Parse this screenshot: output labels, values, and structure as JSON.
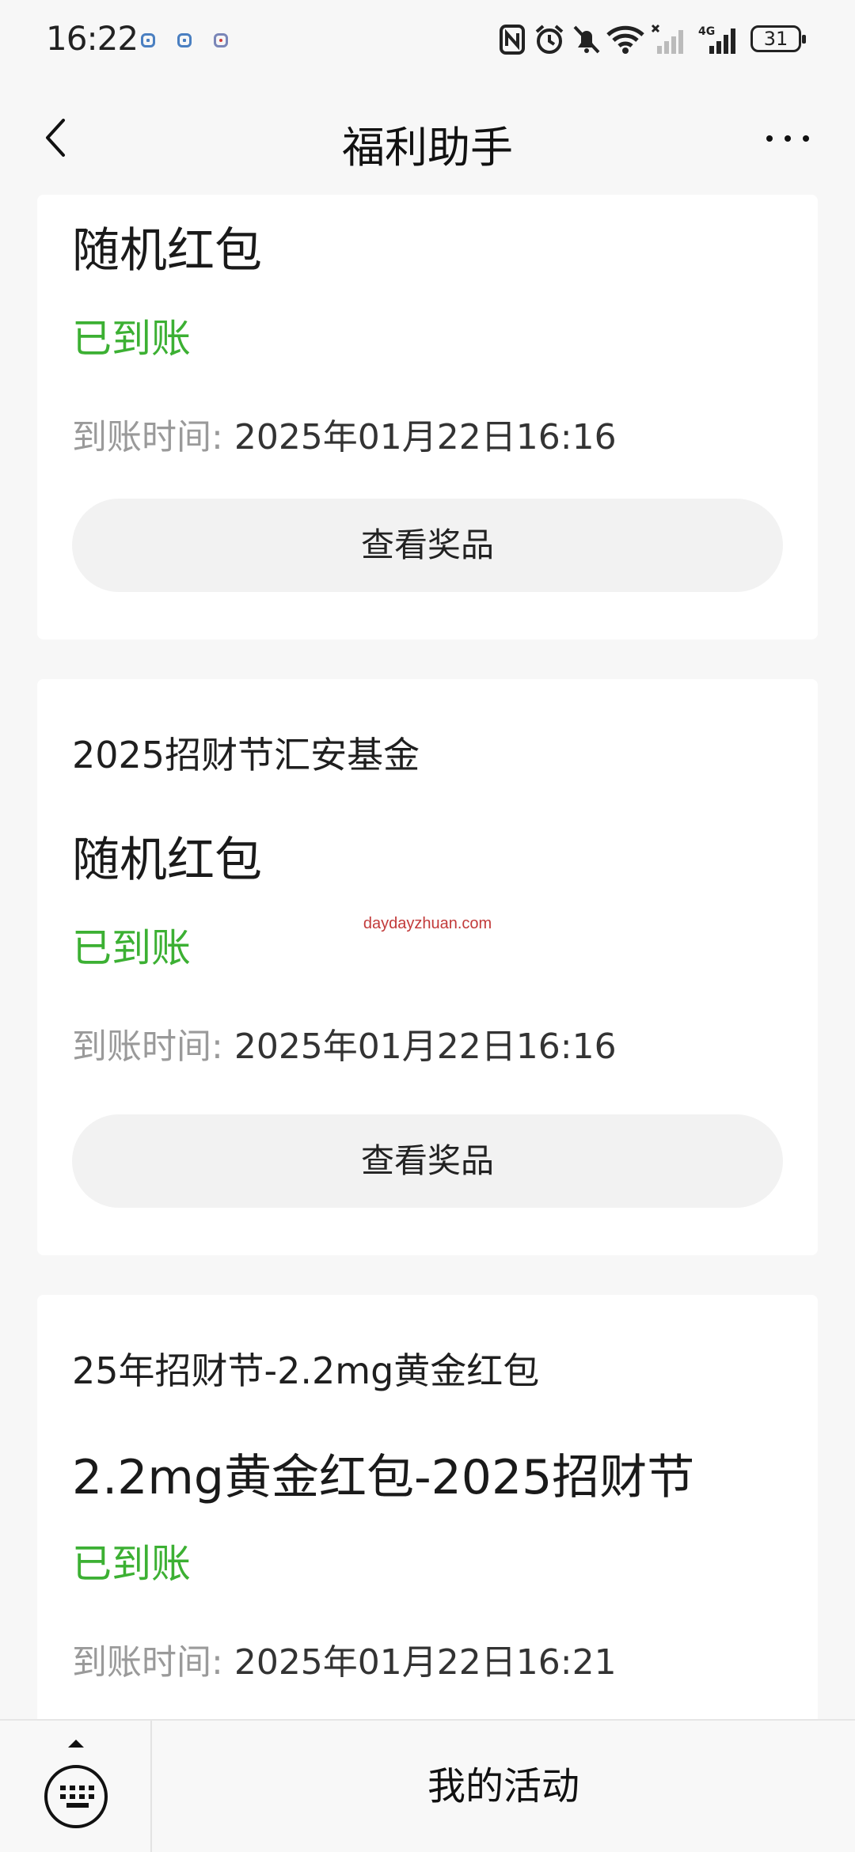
{
  "status_bar": {
    "time": "16:22",
    "battery_level": "31",
    "icons": [
      "app-notification-icon",
      "app-notification-icon",
      "app-notification-icon",
      "nfc-icon",
      "alarm-icon",
      "mute-icon",
      "wifi-icon",
      "signal-icon",
      "4g-signal-icon",
      "battery-icon"
    ]
  },
  "nav": {
    "title": "福利助手",
    "back_icon": "chevron-left-icon",
    "more_icon": "more-horizontal-icon"
  },
  "cards": [
    {
      "title": "随机红包",
      "status": "已到账",
      "time_label": "到账时间:",
      "time_value": "2025年01月22日16:16",
      "button": "查看奖品"
    },
    {
      "subtitle": "2025招财节汇安基金",
      "title": "随机红包",
      "status": "已到账",
      "time_label": "到账时间:",
      "time_value": "2025年01月22日16:16",
      "button": "查看奖品"
    },
    {
      "subtitle": "25年招财节-2.2mg黄金红包",
      "title": "2.2mg黄金红包-2025招财节",
      "status": "已到账",
      "time_label": "到账时间:",
      "time_value": "2025年01月22日16:21"
    }
  ],
  "watermark": "daydayzhuan.com",
  "bottom_bar": {
    "keyboard_icon": "keyboard-icon",
    "menu_label": "我的活动"
  },
  "colors": {
    "status_green": "#3cb033",
    "background": "#f7f7f7",
    "card": "#ffffff",
    "button_bg": "#f2f2f2"
  }
}
